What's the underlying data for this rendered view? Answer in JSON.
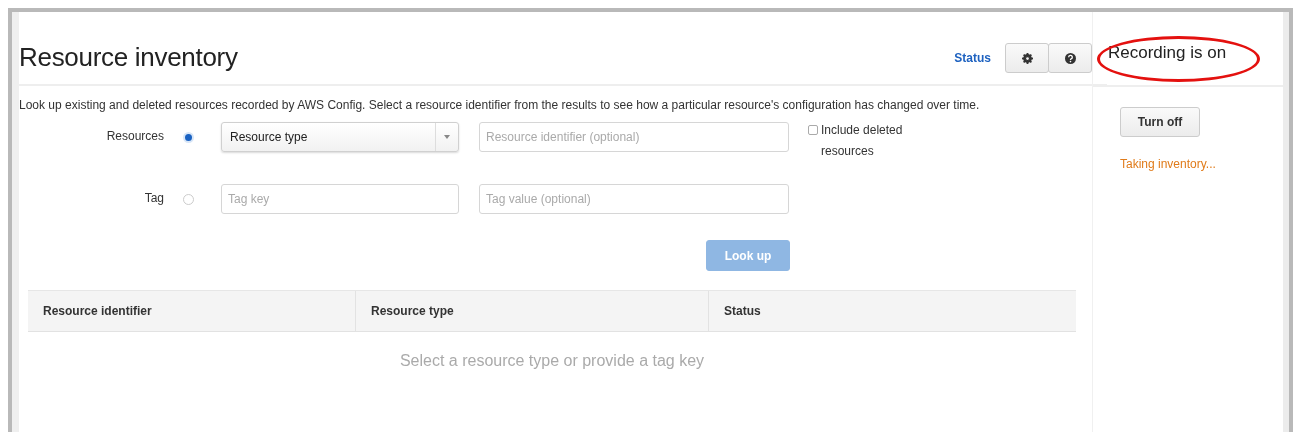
{
  "title": "Resource inventory",
  "status_link": "Status",
  "description": "Look up existing and deleted resources recorded by AWS Config. Select a resource identifier from the results to see how a particular resource's configuration has changed over time.",
  "filters": [
    {
      "label": "Resources",
      "selected": true,
      "kind": "select",
      "first": "Resource type",
      "second": {
        "placeholder": "Resource identifier (optional)"
      }
    },
    {
      "label": "Tag",
      "selected": false,
      "kind": "text",
      "first": {
        "placeholder": "Tag key"
      },
      "second": {
        "placeholder": "Tag value (optional)"
      }
    }
  ],
  "include_deleted": {
    "label": "Include deleted resources",
    "checked": false
  },
  "lookup_button": {
    "label": "Look up",
    "disabled": true
  },
  "table": {
    "columns": [
      "Resource identifier",
      "Resource type",
      "Status"
    ],
    "empty_message": "Select a resource type or provide a tag key"
  },
  "sidebar": {
    "recording": "Recording is on",
    "circled": true,
    "button": "Turn off",
    "status": "Taking inventory..."
  }
}
